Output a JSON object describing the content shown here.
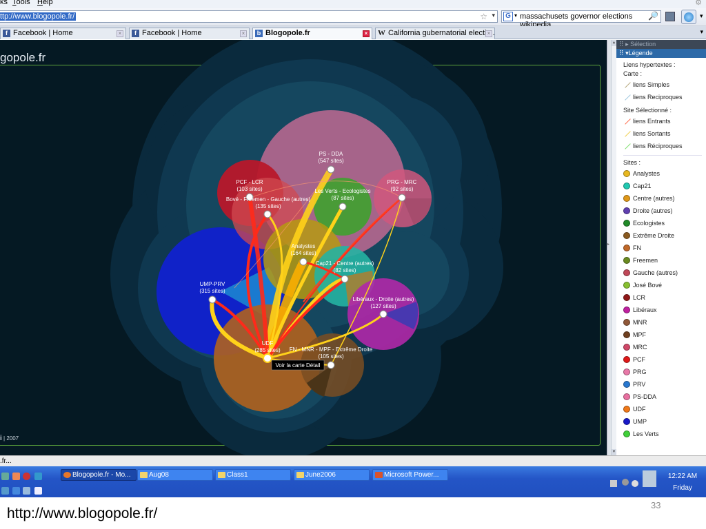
{
  "menu": {
    "items": [
      {
        "label": "ks",
        "underline": ""
      },
      {
        "label": "ools",
        "underline": "T"
      },
      {
        "label": "elp",
        "underline": "H"
      }
    ]
  },
  "address": {
    "url": "ttp://www.blogopole.fr/"
  },
  "search": {
    "value": "massachusets governor elections wikipedia",
    "engine_icon": "google-icon"
  },
  "tabs": [
    {
      "label": "Facebook | Home",
      "icon": "facebook-icon",
      "active": false
    },
    {
      "label": "Facebook | Home",
      "icon": "facebook-icon",
      "active": false
    },
    {
      "label": "Blogopole.fr",
      "icon": "blogopole-icon",
      "active": true
    },
    {
      "label": "California gubernatorial electio...",
      "icon": "wikipedia-icon",
      "active": false
    }
  ],
  "page": {
    "title": "gopole.fr",
    "copyright": {
      "mark": "i",
      "year": "| 2007"
    },
    "tooltip": "Voir la carte Détail"
  },
  "clusters": [
    {
      "name": "PS - DDA",
      "count": "(547 sites)",
      "color": "#c06a92"
    },
    {
      "name": "PCF - LCR",
      "count": "(103 sites)",
      "color": "#c42a34"
    },
    {
      "name": "Bové - Freemen - Gauche (autres)",
      "count": "(135 sites)",
      "color": "#c84a5a"
    },
    {
      "name": "Les Verts - Ecologistes",
      "count": "(87 sites)",
      "color": "#3fa12e"
    },
    {
      "name": "PRG - MRC",
      "count": "(92 sites)",
      "color": "#d0577c"
    },
    {
      "name": "Analystes",
      "count": "(164 sites)",
      "color": "#b59a12"
    },
    {
      "name": "Cap21 - Centre (autres)",
      "count": "(82 sites)",
      "color": "#25b3a2"
    },
    {
      "name": "UMP-PRV",
      "count": "(315 sites)",
      "color": "#1022c8"
    },
    {
      "name": "Libéraux - Droite (autres)",
      "count": "(127 sites)",
      "color": "#b028a8"
    },
    {
      "name": "UDF",
      "count": "(285 sites)",
      "color": "#b0621e"
    },
    {
      "name": "FN - MNR - MPF - Extrême Droite",
      "count": "(105 sites)",
      "color": "#7a4e22"
    }
  ],
  "sidebar": {
    "selection_label": "Sélection",
    "legend_label": "Légende",
    "hypertext_label": "Liens hypertextes :",
    "map_label": "Carte :",
    "map_links": [
      {
        "label": "liens Simples",
        "color": "#b8aa80"
      },
      {
        "label": "liens Reciproques",
        "color": "#a0c8e0"
      }
    ],
    "selected_label": "Site Sélectionné :",
    "selected_links": [
      {
        "label": "liens Entrants",
        "color": "#ff7050"
      },
      {
        "label": "liens Sortants",
        "color": "#f0d050"
      },
      {
        "label": "liens Réciproques",
        "color": "#80e070"
      }
    ],
    "sites_label": "Sites :",
    "sites": [
      {
        "label": "Analystes",
        "color": "#e8b820"
      },
      {
        "label": "Cap21",
        "color": "#20c8b0"
      },
      {
        "label": "Centre (autres)",
        "color": "#e09818"
      },
      {
        "label": "Droite (autres)",
        "color": "#6040b0"
      },
      {
        "label": "Ecologistes",
        "color": "#208a28"
      },
      {
        "label": "Extrême Droite",
        "color": "#8a5a20"
      },
      {
        "label": "FN",
        "color": "#c06828"
      },
      {
        "label": "Freemen",
        "color": "#6a8a20"
      },
      {
        "label": "Gauche (autres)",
        "color": "#c04858"
      },
      {
        "label": "José Bové",
        "color": "#88c030"
      },
      {
        "label": "LCR",
        "color": "#901818"
      },
      {
        "label": "Libéraux",
        "color": "#c020a0"
      },
      {
        "label": "MNR",
        "color": "#905838"
      },
      {
        "label": "MPF",
        "color": "#704020"
      },
      {
        "label": "MRC",
        "color": "#d04868"
      },
      {
        "label": "PCF",
        "color": "#e01818"
      },
      {
        "label": "PRG",
        "color": "#e878a8"
      },
      {
        "label": "PRV",
        "color": "#2878d0"
      },
      {
        "label": "PS-DDA",
        "color": "#e870a0"
      },
      {
        "label": "UDF",
        "color": "#f07818"
      },
      {
        "label": "UMP",
        "color": "#1818c8"
      },
      {
        "label": "Les Verts",
        "color": "#40d038"
      }
    ]
  },
  "statusbar": {
    "text": ".fr..."
  },
  "taskbar": {
    "tasks": [
      {
        "label": "Blogopole.fr - Mo...",
        "icon": "firefox-icon",
        "active": true
      },
      {
        "label": "Aug08",
        "icon": "folder-icon",
        "active": false
      },
      {
        "label": "Class1",
        "icon": "folder-icon",
        "active": false
      },
      {
        "label": "June2006",
        "icon": "folder-icon",
        "active": false
      },
      {
        "label": "Microsoft Power...",
        "icon": "powerpoint-icon",
        "active": false
      }
    ],
    "clock_time": "12:22 AM",
    "clock_day": "Friday"
  },
  "slide": {
    "footer_url": "http://www.blogopole.fr/",
    "page_number": "33"
  }
}
